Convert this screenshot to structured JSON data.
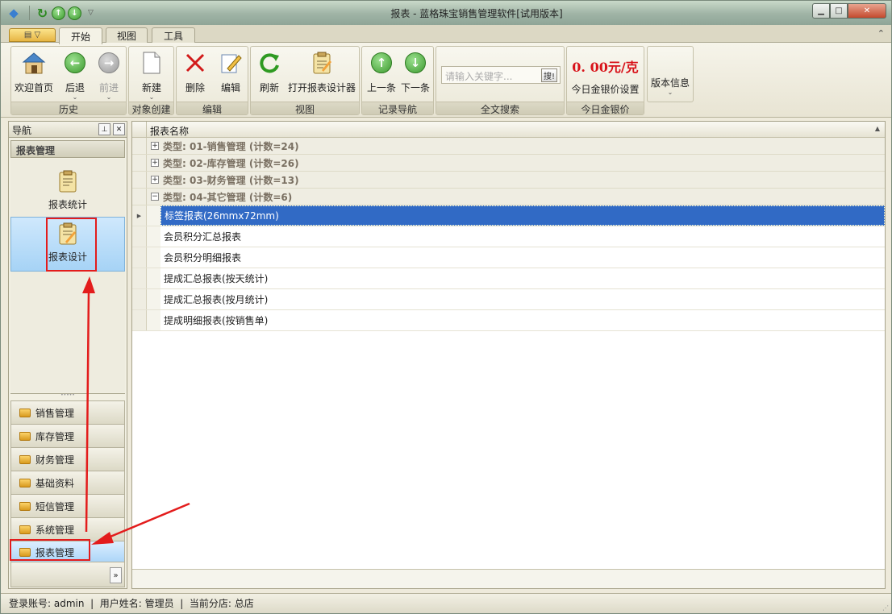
{
  "window": {
    "title": "报表 - 蓝格珠宝销售管理软件[试用版本]"
  },
  "tabs": [
    {
      "label": "开始",
      "active": true
    },
    {
      "label": "视图"
    },
    {
      "label": "工具"
    }
  ],
  "ribbon": {
    "history": {
      "label": "历史",
      "buttons": [
        "欢迎首页",
        "后退",
        "前进"
      ]
    },
    "create": {
      "label": "对象创建",
      "buttons": [
        "新建"
      ]
    },
    "edit": {
      "label": "编辑",
      "buttons": [
        "删除",
        "编辑"
      ]
    },
    "view": {
      "label": "视图",
      "buttons": [
        "刷新",
        "打开报表设计器"
      ]
    },
    "nav": {
      "label": "记录导航",
      "buttons": [
        "上一条",
        "下一条"
      ]
    },
    "search": {
      "label": "全文搜索",
      "placeholder": "请输入关键字...",
      "button": "搜!"
    },
    "gold": {
      "label": "今日金银价",
      "price": "0. 00元/克",
      "setting": "今日金银价设置"
    },
    "version": {
      "button": "版本信息"
    }
  },
  "nav": {
    "title": "导航",
    "group": "报表管理",
    "items": [
      "报表统计",
      "报表设计"
    ],
    "bars": [
      "销售管理",
      "库存管理",
      "财务管理",
      "基础资料",
      "短信管理",
      "系统管理",
      "报表管理"
    ]
  },
  "grid": {
    "header": "报表名称",
    "groups": [
      "类型: 01-销售管理 (计数=24)",
      "类型: 02-库存管理 (计数=26)",
      "类型: 03-财务管理 (计数=13)",
      "类型: 04-其它管理 (计数=6)"
    ],
    "rows": [
      "标签报表(26mmx72mm)",
      "会员积分汇总报表",
      "会员积分明细报表",
      "提成汇总报表(按天统计)",
      "提成汇总报表(按月统计)",
      "提成明细报表(按销售单)"
    ]
  },
  "status": {
    "text": "登录账号: admin  |  用户姓名: 管理员  |  当前分店: 总店"
  },
  "colors": {
    "accent": "#316ac5",
    "annotation": "#e31c1c",
    "price": "#d8131a"
  }
}
